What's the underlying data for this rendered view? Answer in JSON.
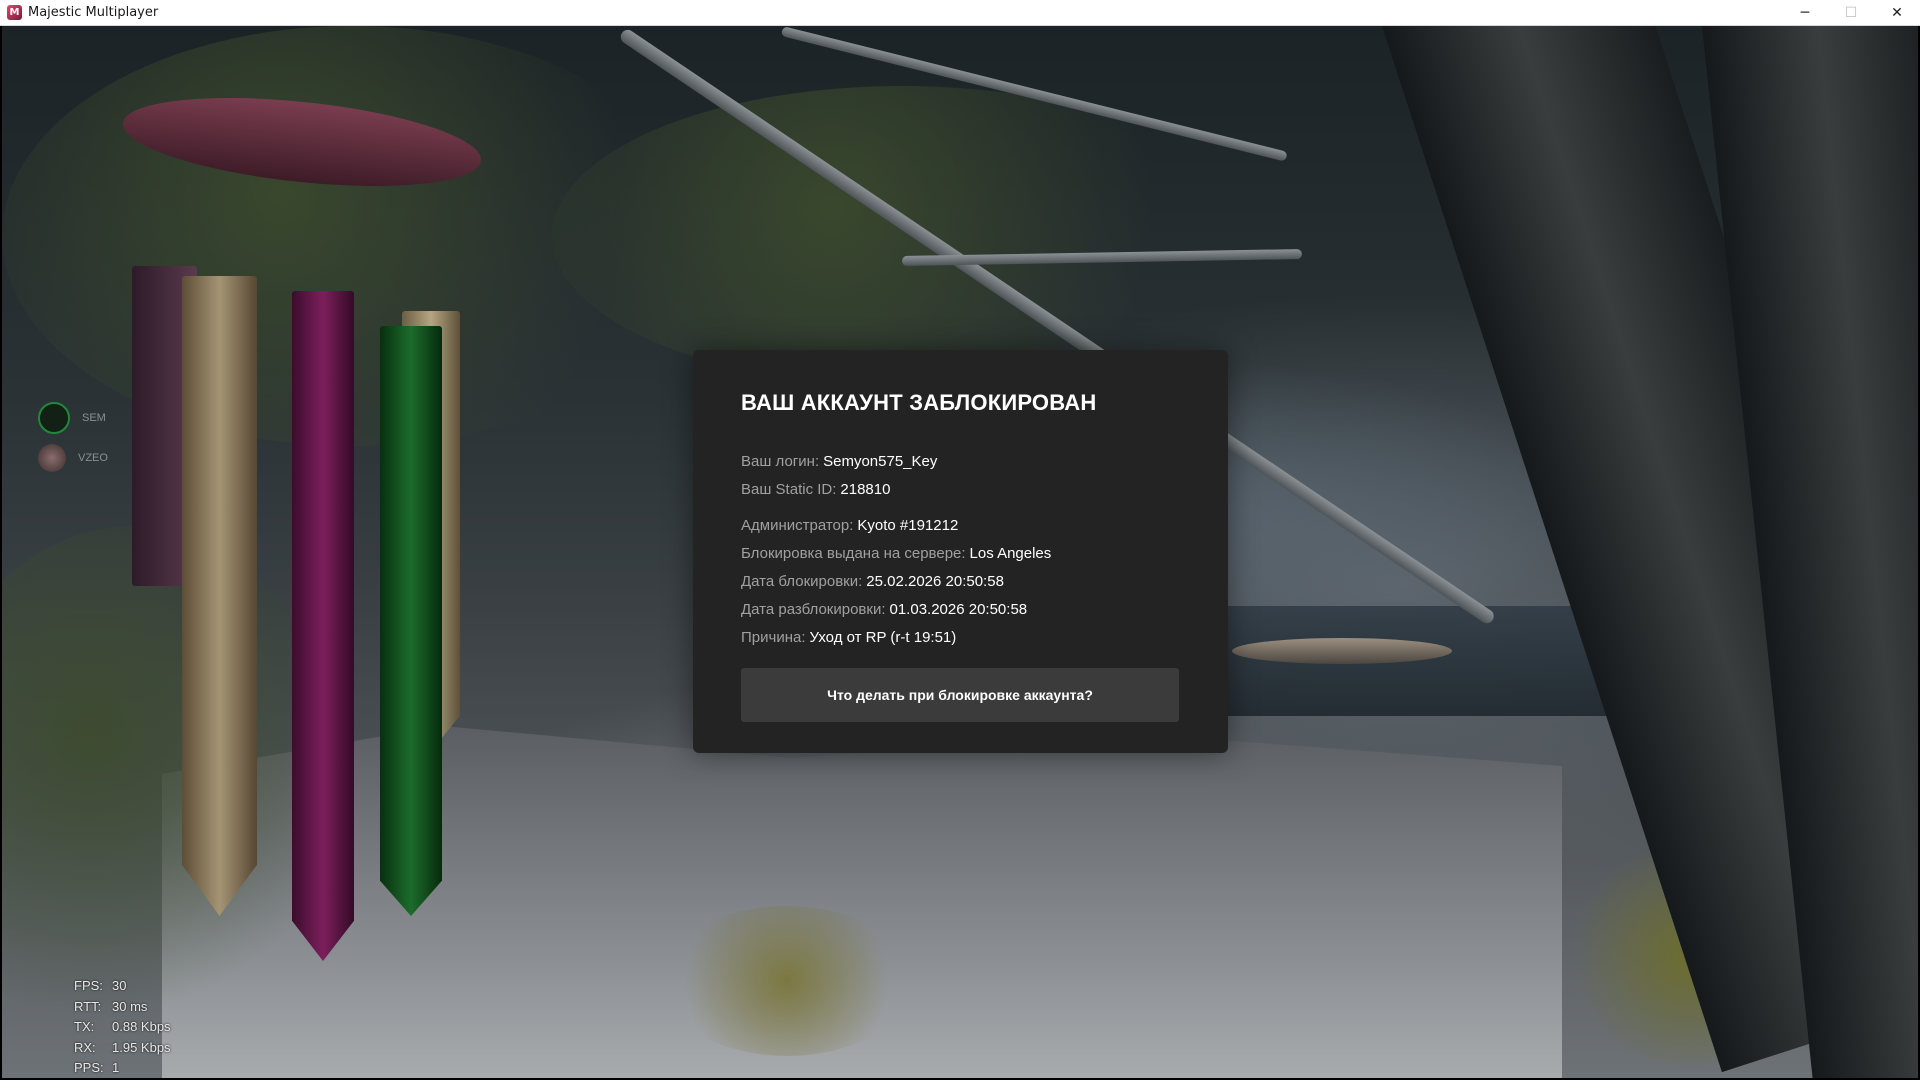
{
  "window": {
    "title": "Majestic Multiplayer",
    "icon": "majestic-logo-icon",
    "controls": {
      "minimize": "─",
      "maximize": "☐",
      "close": "✕"
    }
  },
  "voice_chat": [
    {
      "name": "SEM",
      "icon": "microphone-headset-icon"
    },
    {
      "name": "VZEO",
      "icon": "avatar-icon"
    }
  ],
  "ban_dialog": {
    "title": "ВАШ АККАУНТ ЗАБЛОКИРОВАН",
    "login_label": "Ваш логин:",
    "login_value": "Semyon575_Key",
    "static_id_label": "Ваш Static ID:",
    "static_id_value": "218810",
    "admin_label": "Администратор:",
    "admin_value": "Kyoto #191212",
    "server_label": "Блокировка выдана на сервере:",
    "server_value": "Los Angeles",
    "ban_date_label": "Дата блокировки:",
    "ban_date_value": "25.02.2026 20:50:58",
    "unban_date_label": "Дата разблокировки:",
    "unban_date_value": "01.03.2026 20:50:58",
    "reason_label": "Причина:",
    "reason_value": "Уход от RP (r-t 19:51)",
    "help_button": "Что делать при блокировке аккаунта?"
  },
  "net_stats": [
    {
      "key": "FPS:",
      "value": "30"
    },
    {
      "key": "RTT:",
      "value": "30 ms"
    },
    {
      "key": "TX:",
      "value": "0.88 Kbps"
    },
    {
      "key": "RX:",
      "value": "1.95 Kbps"
    },
    {
      "key": "PPS:",
      "value": "1"
    }
  ],
  "colors": {
    "modal_bg": "#232323",
    "button_bg": "#3b3b3b",
    "label": "#a0a0a0",
    "value": "#ffffff"
  }
}
